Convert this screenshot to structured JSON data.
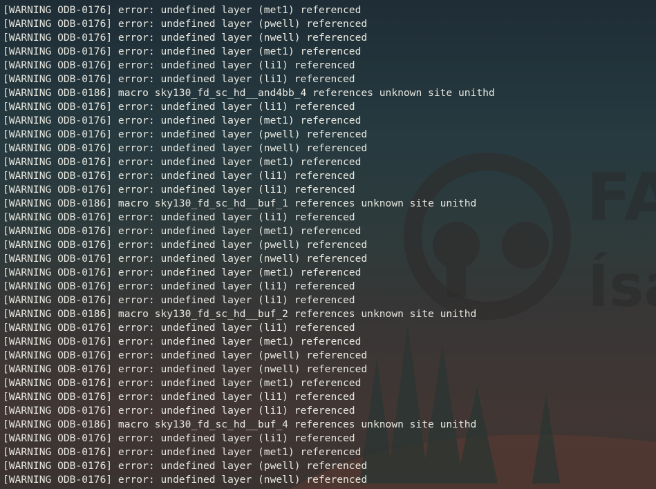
{
  "background": {
    "logo_line1": "FA",
    "logo_line2": "Ísa",
    "colors": {
      "sky": "#1f2d36",
      "horizon": "#4a3430",
      "logo": "#2a2a2a",
      "text": "#e8e8e0"
    }
  },
  "terminal": {
    "lines": [
      "[WARNING ODB-0176] error: undefined layer (met1) referenced",
      "[WARNING ODB-0176] error: undefined layer (pwell) referenced",
      "[WARNING ODB-0176] error: undefined layer (nwell) referenced",
      "[WARNING ODB-0176] error: undefined layer (met1) referenced",
      "[WARNING ODB-0176] error: undefined layer (li1) referenced",
      "[WARNING ODB-0176] error: undefined layer (li1) referenced",
      "[WARNING ODB-0186] macro sky130_fd_sc_hd__and4bb_4 references unknown site unithd",
      "[WARNING ODB-0176] error: undefined layer (li1) referenced",
      "[WARNING ODB-0176] error: undefined layer (met1) referenced",
      "[WARNING ODB-0176] error: undefined layer (pwell) referenced",
      "[WARNING ODB-0176] error: undefined layer (nwell) referenced",
      "[WARNING ODB-0176] error: undefined layer (met1) referenced",
      "[WARNING ODB-0176] error: undefined layer (li1) referenced",
      "[WARNING ODB-0176] error: undefined layer (li1) referenced",
      "[WARNING ODB-0186] macro sky130_fd_sc_hd__buf_1 references unknown site unithd",
      "[WARNING ODB-0176] error: undefined layer (li1) referenced",
      "[WARNING ODB-0176] error: undefined layer (met1) referenced",
      "[WARNING ODB-0176] error: undefined layer (pwell) referenced",
      "[WARNING ODB-0176] error: undefined layer (nwell) referenced",
      "[WARNING ODB-0176] error: undefined layer (met1) referenced",
      "[WARNING ODB-0176] error: undefined layer (li1) referenced",
      "[WARNING ODB-0176] error: undefined layer (li1) referenced",
      "[WARNING ODB-0186] macro sky130_fd_sc_hd__buf_2 references unknown site unithd",
      "[WARNING ODB-0176] error: undefined layer (li1) referenced",
      "[WARNING ODB-0176] error: undefined layer (met1) referenced",
      "[WARNING ODB-0176] error: undefined layer (pwell) referenced",
      "[WARNING ODB-0176] error: undefined layer (nwell) referenced",
      "[WARNING ODB-0176] error: undefined layer (met1) referenced",
      "[WARNING ODB-0176] error: undefined layer (li1) referenced",
      "[WARNING ODB-0176] error: undefined layer (li1) referenced",
      "[WARNING ODB-0186] macro sky130_fd_sc_hd__buf_4 references unknown site unithd",
      "[WARNING ODB-0176] error: undefined layer (li1) referenced",
      "[WARNING ODB-0176] error: undefined layer (met1) referenced",
      "[WARNING ODB-0176] error: undefined layer (pwell) referenced",
      "[WARNING ODB-0176] error: undefined layer (nwell) referenced"
    ]
  }
}
